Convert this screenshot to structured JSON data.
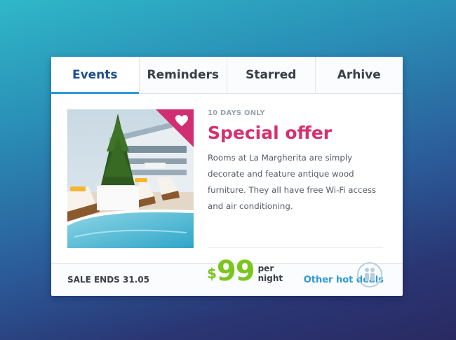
{
  "tabs": [
    {
      "label": "Events",
      "active": true
    },
    {
      "label": "Reminders",
      "active": false
    },
    {
      "label": "Starred",
      "active": false
    },
    {
      "label": "Arhive",
      "active": false
    }
  ],
  "offer": {
    "eyebrow": "10 DAYS ONLY",
    "title": "Special offer",
    "description": "Rooms at La Margherita are simply decorate and feature antique wood furniture. They all have free Wi-Fi access and air conditioning.",
    "price_currency": "$",
    "price_amount": "99",
    "price_unit_line1": "per",
    "price_unit_line2": "night",
    "favorite_icon": "heart-icon",
    "guests_icon": "two-people-icon"
  },
  "footer": {
    "sale_text": "SALE ENDS 31.05",
    "deals_link": "Other hot deals"
  },
  "colors": {
    "accent_blue": "#2d9ad7",
    "offer_pink": "#d6306e",
    "price_green": "#7bc51f",
    "tab_active_text": "#1d4f8c"
  }
}
